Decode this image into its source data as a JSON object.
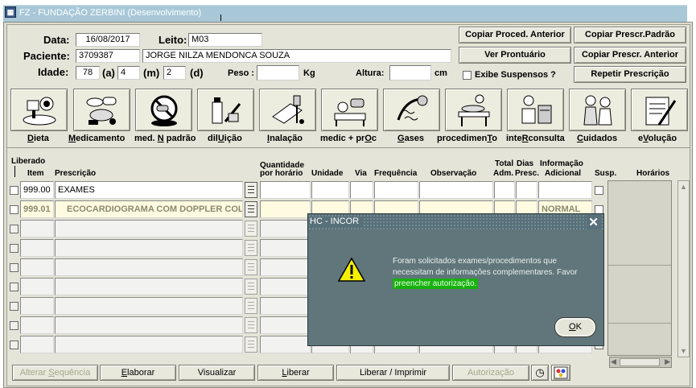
{
  "window": {
    "title": "FZ - FUNDAÇÃO ZERBINI (Desenvolvimento)"
  },
  "header": {
    "data_label": "Data:",
    "data_value": "16/08/2017",
    "leito_label": "Leito:",
    "leito_value": "M03",
    "paciente_label": "Paciente:",
    "paciente_id": "3709387",
    "paciente_nome": "JORGE NILZA MENDONCA SOUZA",
    "idade_label": "Idade:",
    "idade_anos": "78",
    "anos_unit": "(a)",
    "idade_meses": "4",
    "meses_unit": "(m)",
    "idade_dias": "2",
    "dias_unit": "(d)",
    "peso_label": "Peso :",
    "peso_value": "",
    "peso_unit": "Kg",
    "altura_label": "Altura:",
    "altura_value": "",
    "altura_unit": "cm",
    "exibe_suspensos": "Exibe Suspensos ?"
  },
  "actions": {
    "copiar_proced": "Copiar Proced. Anterior",
    "copiar_padrao": "Copiar Prescr.Padrão",
    "ver_prontuario": "Ver Prontuário",
    "copiar_anterior": "Copiar Prescr. Anterior",
    "repetir": "Repetir Prescrição"
  },
  "categories": [
    {
      "pre": "",
      "u": "D",
      "post": "ieta",
      "icon": "diet-icon"
    },
    {
      "pre": "",
      "u": "M",
      "post": "edicamento",
      "icon": "medication-icon"
    },
    {
      "pre": "med. ",
      "u": "N",
      "post": " padrão",
      "icon": "no-medication-icon"
    },
    {
      "pre": "dil",
      "u": "U",
      "post": "ição",
      "icon": "dilution-icon"
    },
    {
      "pre": "",
      "u": "I",
      "post": "nalação",
      "icon": "inhalation-icon"
    },
    {
      "pre": "medic + pr",
      "u": "O",
      "post": "c",
      "icon": "medic-proc-icon"
    },
    {
      "pre": "",
      "u": "G",
      "post": "ases",
      "icon": "gases-icon"
    },
    {
      "pre": "procedimen",
      "u": "T",
      "post": "o",
      "icon": "procedure-icon"
    },
    {
      "pre": "inte",
      "u": "R",
      "post": "consulta",
      "icon": "consultation-icon"
    },
    {
      "pre": "",
      "u": "C",
      "post": "uidados",
      "icon": "care-icon"
    },
    {
      "pre": "e",
      "u": "V",
      "post": "olução",
      "icon": "evolution-icon"
    }
  ],
  "table": {
    "h_liberado": "Liberado",
    "h_item": "Item",
    "h_prescricao": "Prescrição",
    "h_qtd1": "Quantidade",
    "h_qtd2": "por horário",
    "h_unidade": "Unidade",
    "h_via": "Via",
    "h_frequencia": "Frequência",
    "h_observacao": "Observação",
    "h_total1": "Total",
    "h_total2": "Adm.",
    "h_dias1": "Dias",
    "h_dias2": "Presc.",
    "h_info1": "Informação",
    "h_info2": "Adicional",
    "h_susp": "Susp.",
    "h_horarios": "Horários",
    "rows": [
      {
        "item": "999.00",
        "prescricao": "EXAMES",
        "info": ""
      },
      {
        "item": "999.01",
        "prescricao": "ECOCARDIOGRAMA COM DOPPLER COLO",
        "info": "NORMAL"
      }
    ]
  },
  "footer": {
    "alterar_pre": "Alterar ",
    "alterar_u": "S",
    "alterar_post": "equência",
    "elaborar_u": "E",
    "elaborar_post": "laborar",
    "visualizar": "Visualizar",
    "liberar_u": "L",
    "liberar_post": "iberar",
    "liberar_imprimir": "Liberar / Imprimir",
    "autorizacao": "Autorização"
  },
  "dialog": {
    "title": "HC - INCOR",
    "message": "Foram solicitados exames/procedimentos que necessitam de informações complementares. Favor",
    "link": "preencher autorização.",
    "ok_u": "O",
    "ok_post": "K"
  }
}
